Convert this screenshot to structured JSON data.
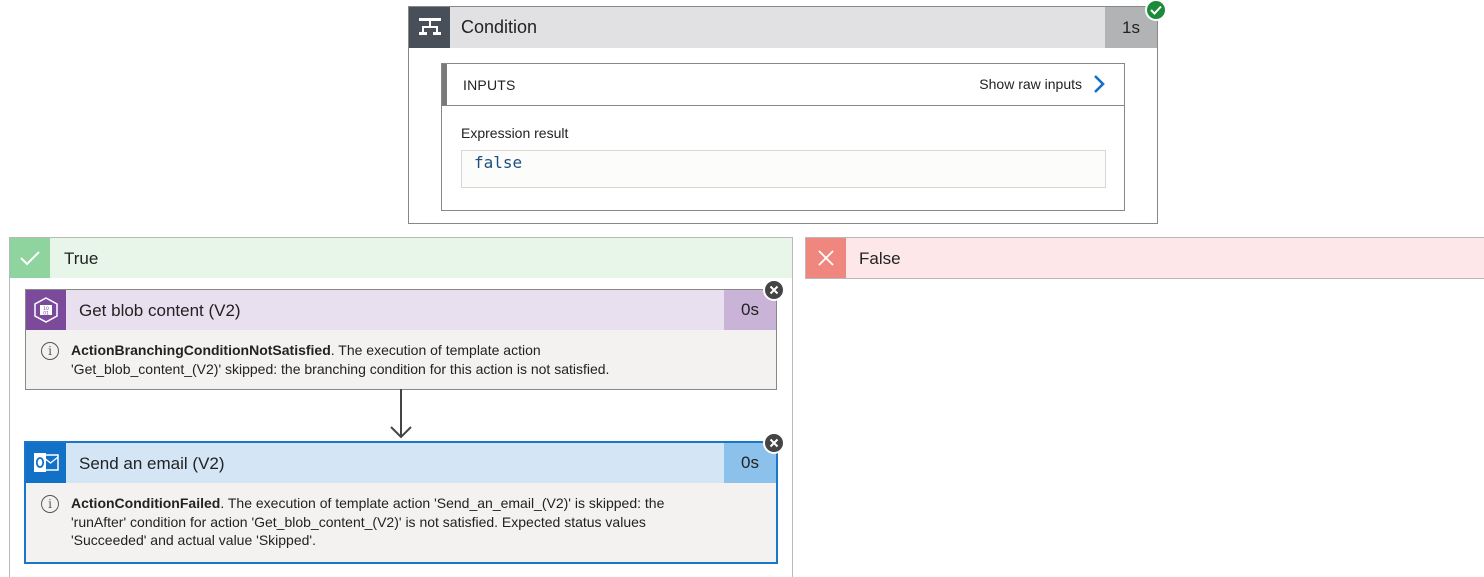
{
  "condition": {
    "title": "Condition",
    "duration": "1s",
    "status": "succeeded",
    "icon": "condition-icon",
    "inputs": {
      "header": "INPUTS",
      "show_raw_label": "Show raw inputs",
      "expression_label": "Expression result",
      "expression_value": "false"
    }
  },
  "true_branch": {
    "label": "True",
    "actions": [
      {
        "title": "Get blob content (V2)",
        "duration": "0s",
        "icon": "blob-storage-icon",
        "message_code": "ActionBranchingConditionNotSatisfied",
        "message_line1": ". The execution of template action",
        "message_line2": "'Get_blob_content_(V2)' skipped: the branching condition for this action is not satisfied."
      },
      {
        "title": "Send an email (V2)",
        "duration": "0s",
        "icon": "outlook-icon",
        "message_code": "ActionConditionFailed",
        "message_line1": ". The execution of template action 'Send_an_email_(V2)' is skipped: the",
        "message_line2": "'runAfter' condition for action 'Get_blob_content_(V2)' is not satisfied. Expected status values",
        "message_line3": "'Succeeded' and actual value 'Skipped'."
      }
    ]
  },
  "false_branch": {
    "label": "False"
  },
  "colors": {
    "true_accent": "#8fd49f",
    "false_accent": "#f0877f",
    "blob_accent": "#7b4a9b",
    "outlook_accent": "#1370c7",
    "success": "#1b8a3a"
  }
}
